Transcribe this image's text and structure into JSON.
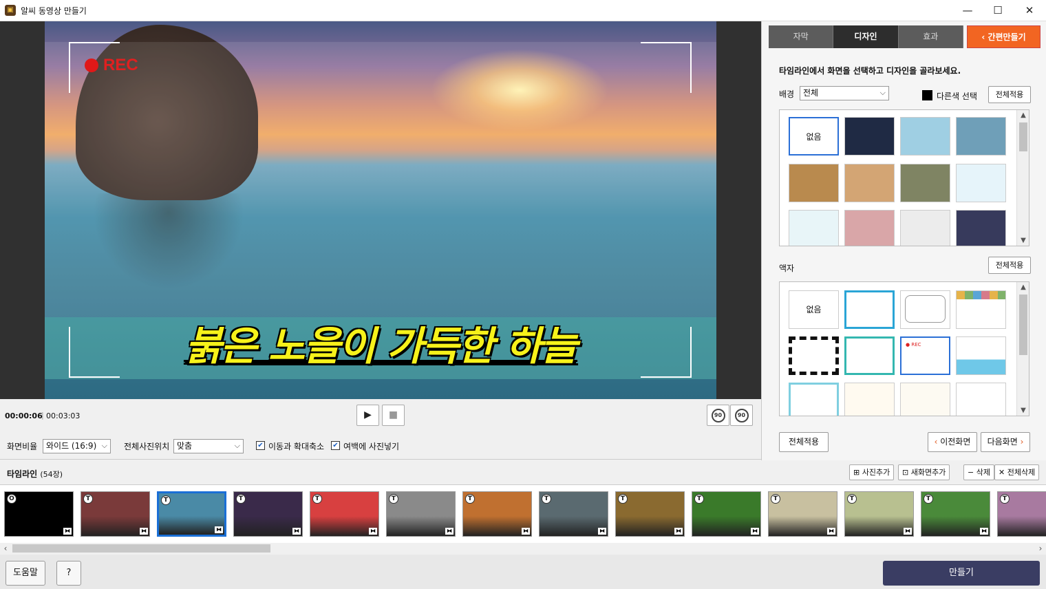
{
  "window": {
    "title": "알씨 동영상 만들기",
    "min": "—",
    "max": "☐",
    "close": "✕"
  },
  "preview": {
    "rec_label": "REC",
    "caption": "붉은 노을이 가득한 하늘"
  },
  "player": {
    "current_time": "00:00:06",
    "total_time": "00:03:03",
    "play_icon": "▶",
    "stop_icon": "■",
    "rotate_left": "90",
    "rotate_right": "90"
  },
  "options": {
    "ratio_label": "화면비율",
    "ratio_value": "와이드 (16:9)",
    "position_label": "전체사진위치",
    "position_value": "맞춤",
    "move_zoom_label": "이동과 확대축소",
    "move_zoom_checked": true,
    "margin_fill_label": "여백에 사진넣기",
    "margin_fill_checked": true
  },
  "panel": {
    "tabs": [
      {
        "label": "자막"
      },
      {
        "label": "디자인"
      },
      {
        "label": "효과"
      }
    ],
    "easy_make": "간편만들기",
    "instruction": "타임라인에서 화면을 선택하고 디자인을 골라보세요.",
    "background_label": "배경",
    "background_filter": "전체",
    "other_color_label": "다른색 선택",
    "apply_all": "전체적용",
    "none_label": "없음",
    "frame_label": "액자",
    "bottom_apply_all": "전체적용",
    "prev_screen": "이전화면",
    "next_screen": "다음화면",
    "bg_colors": [
      "#ffffff",
      "#1f2a44",
      "#9fcfe3",
      "#6f9fb8",
      "#b98a4e",
      "#d3a574",
      "#7f8463",
      "#e6f4fa",
      "#e8f5f8",
      "#d9a6a8",
      "#ececec",
      "#373a5c"
    ]
  },
  "timeline": {
    "title": "타임라인",
    "count": "(54장)",
    "add_photo": "사진추가",
    "add_screen": "새화면추가",
    "delete": "삭제",
    "delete_all": "전체삭제",
    "items": [
      {
        "badge": "O",
        "color": "#000000"
      },
      {
        "badge": "T",
        "color": "#7a3a3a"
      },
      {
        "badge": "T",
        "color": "#4a8aa6"
      },
      {
        "badge": "T",
        "color": "#3a2a4a"
      },
      {
        "badge": "T",
        "color": "#d84040"
      },
      {
        "badge": "T",
        "color": "#8a8a8a"
      },
      {
        "badge": "T",
        "color": "#c07030"
      },
      {
        "badge": "T",
        "color": "#5a6a70"
      },
      {
        "badge": "T",
        "color": "#8a6a30"
      },
      {
        "badge": "T",
        "color": "#3a7a2a"
      },
      {
        "badge": "T",
        "color": "#c8c0a0"
      },
      {
        "badge": "T",
        "color": "#b8c090"
      },
      {
        "badge": "T",
        "color": "#4a8a3a"
      },
      {
        "badge": "T",
        "color": "#a87aa0"
      }
    ]
  },
  "footer": {
    "help": "도움말",
    "question": "?",
    "make": "만들기"
  }
}
